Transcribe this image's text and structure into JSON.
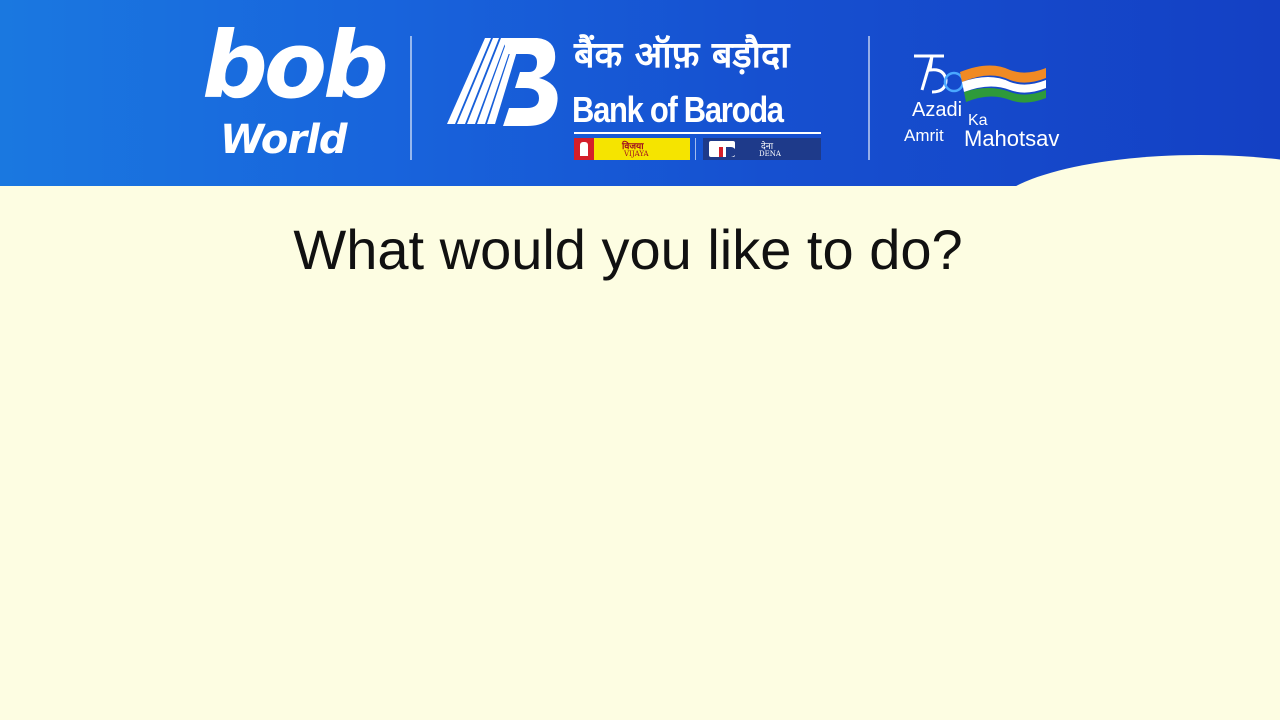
{
  "header": {
    "bob_word": "bob",
    "bob_world": "World",
    "bank_hindi": "बैंक ऑफ़ बड़ौदा",
    "bank_name": "Bank of Baroda",
    "vijaya_hindi": "विजया",
    "vijaya_english": "VIJAYA",
    "dena_hindi": "देना",
    "dena_english": "DENA",
    "azadi": "Azadi",
    "ka": "Ka",
    "amrit": "Amrit",
    "mahotsav": "Mahotsav",
    "brand_colors": {
      "primary_blue": "#1650d0",
      "saffron": "#f08a24",
      "green": "#2e9a3a"
    }
  },
  "main": {
    "prompt": "What would you like to do?"
  },
  "colors": {
    "background": "#fdfde2",
    "text": "#111111"
  }
}
